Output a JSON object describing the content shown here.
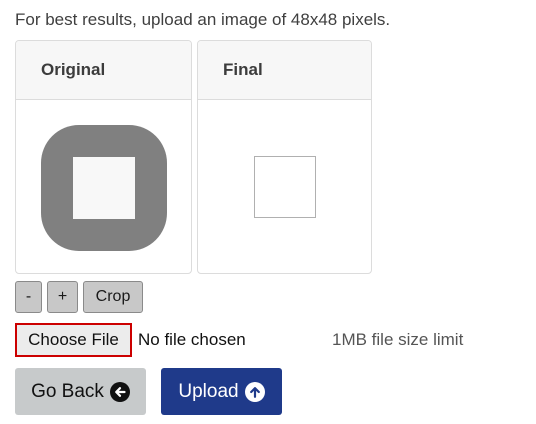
{
  "hint": "For best results, upload an image of 48x48 pixels.",
  "panels": {
    "original_label": "Original",
    "final_label": "Final"
  },
  "controls": {
    "zoom_out_label": "-",
    "zoom_in_label": "+",
    "crop_label": "Crop"
  },
  "file": {
    "choose_label": "Choose File",
    "status": "No file chosen",
    "size_limit": "1MB file size limit"
  },
  "actions": {
    "go_back_label": "Go Back",
    "go_back_icon": "arrow-left-circle-icon",
    "upload_label": "Upload",
    "upload_icon": "arrow-up-circle-icon"
  },
  "colors": {
    "primary": "#1f3a8a",
    "secondary": "#c7cacb",
    "highlight_border": "#cc0000"
  }
}
